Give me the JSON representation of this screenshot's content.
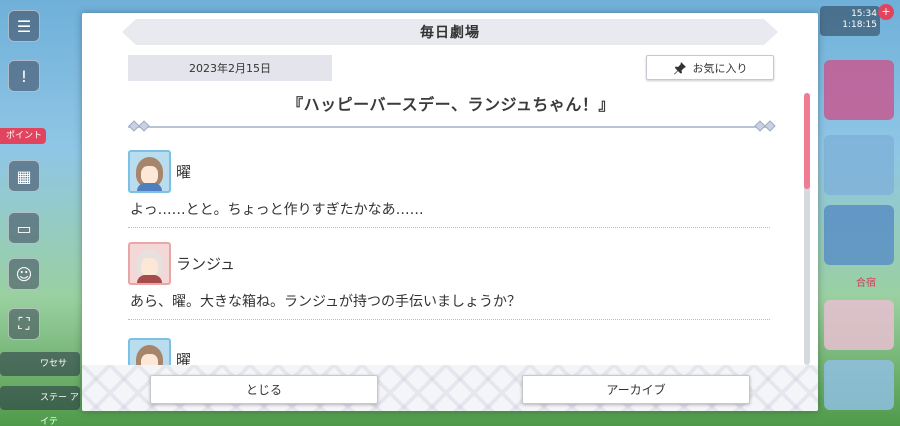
{
  "background": {
    "left_labels": [
      "ポイント",
      "ワセサ",
      "ステー アイテ"
    ],
    "right_labels": [
      "合宿"
    ],
    "status_lines": [
      "15:34",
      "1:18:15"
    ],
    "notification_count": "+"
  },
  "modal": {
    "title": "毎日劇場",
    "date": "2023年2月15日",
    "favorite_label": "お気に入り",
    "episode_title": "『ハッピーバースデー、ランジュちゃん！』",
    "entries": [
      {
        "speaker": "曜",
        "avatar": "you",
        "text": "よっ……とと。ちょっと作りすぎたかなあ……"
      },
      {
        "speaker": "ランジュ",
        "avatar": "ranju",
        "text": "あら、曜。大きな箱ね。ランジュが持つの手伝いましょうか？"
      },
      {
        "speaker": "曜",
        "avatar": "you",
        "text": ""
      }
    ],
    "close_label": "とじる",
    "archive_label": "アーカイブ"
  },
  "colors": {
    "accent_pink": "#f07c93",
    "banner_bg": "#e9eaf0",
    "date_bg": "#e3e4ec"
  }
}
